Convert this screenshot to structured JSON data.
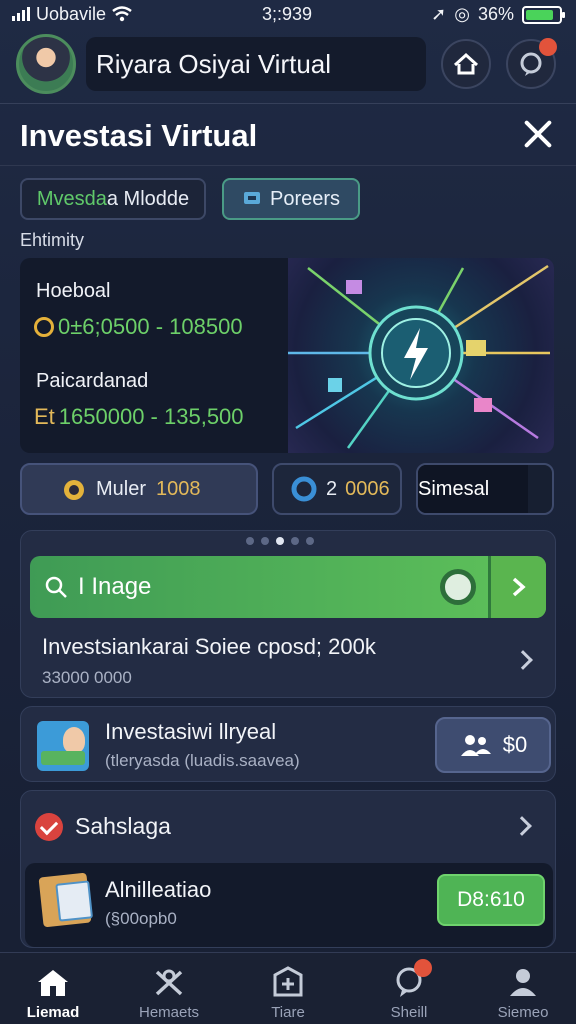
{
  "status_bar": {
    "carrier": "Uobavile",
    "time": "3;:939",
    "battery": "36%",
    "battery_level": 0.85
  },
  "header": {
    "user_name": "Riyara Osiyai Virtual",
    "notification_badge": ""
  },
  "page": {
    "title": "Investasi Virtual"
  },
  "tabs": [
    {
      "label_a": "Mvesda",
      "label_b": "a Mlodde"
    },
    {
      "label": "Poreers"
    }
  ],
  "section_label": "Ehtimity",
  "summary": {
    "row1_label": "Hoeboal",
    "row1_value": "0±6;0500 - 108500",
    "row2_label": "Paicardanad",
    "row2_value_prefix": "Et",
    "row2_value": "1650000 - 135,500"
  },
  "stats": [
    {
      "label": "Muler",
      "value": "1008"
    },
    {
      "label": "2",
      "value": "0006"
    },
    {
      "label": "Simesal"
    }
  ],
  "list": {
    "search_label": "I Inage",
    "item_title": "Investsiankarai Soiee cposd; 200k",
    "item_sub": "33000 0000"
  },
  "card2": {
    "title": "Investasiwi llryeal",
    "subtitle": "(tleryasda (luadis.saavea)",
    "button_label": "$0"
  },
  "card3": {
    "title": "Sahslaga",
    "sub_title": "Alnilleatiao",
    "sub_value": "(§00opb0",
    "button_label": "D8:610"
  },
  "nav": [
    {
      "label": "Liemad",
      "icon": "home-icon"
    },
    {
      "label": "Hemaets",
      "icon": "crossed-icon"
    },
    {
      "label": "Tiare",
      "icon": "plus-box-icon"
    },
    {
      "label": "Sheill",
      "icon": "chat-icon"
    },
    {
      "label": "Siemeo",
      "icon": "profile-icon"
    }
  ],
  "colors": {
    "background": "#1f2a44",
    "accent_green": "#5fc25a",
    "accent_gold": "#e3b95a",
    "badge_red": "#e2533b"
  }
}
